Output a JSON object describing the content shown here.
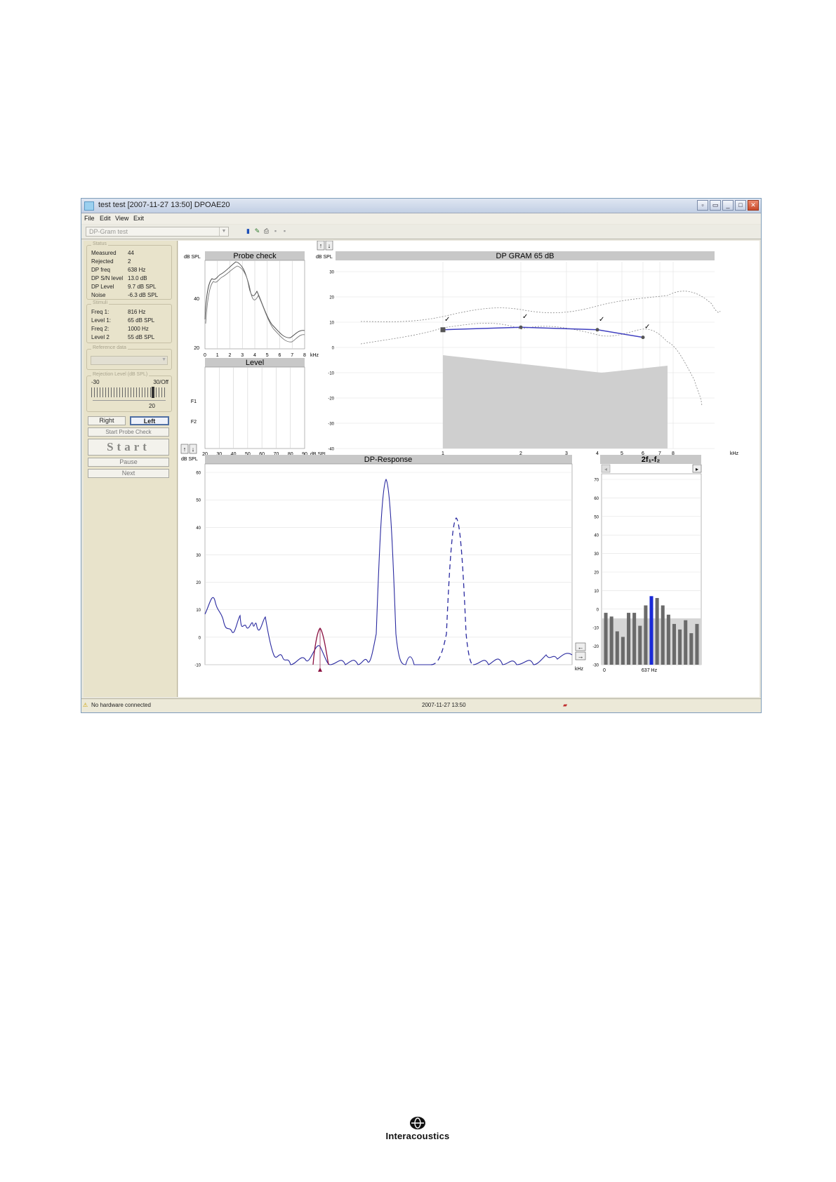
{
  "window": {
    "title": "test test [2007-11-27 13:50] DPOAE20",
    "buttons": [
      "minimize-to-tray",
      "restore-small",
      "minimize",
      "maximize",
      "close"
    ]
  },
  "menu": [
    "File",
    "Edit",
    "View",
    "Exit"
  ],
  "toolbar": {
    "protocol": "DP-Gram test"
  },
  "left_panel": {
    "status_title": "Status",
    "status": [
      {
        "label": "Measured",
        "value": "44"
      },
      {
        "label": "Rejected",
        "value": "2"
      },
      {
        "label": "DP freq",
        "value": "638 Hz"
      },
      {
        "label": "DP S/N level",
        "value": "13.0 dB"
      },
      {
        "label": "DP Level",
        "value": "9.7 dB SPL"
      },
      {
        "label": "Noise",
        "value": "-6.3 dB SPL"
      }
    ],
    "stimuli_title": "Stimuli",
    "stimuli": [
      {
        "label": "Freq 1:",
        "value": "816 Hz"
      },
      {
        "label": "Level 1:",
        "value": "65 dB SPL"
      },
      {
        "label": "Freq 2:",
        "value": "1000 Hz"
      },
      {
        "label": "Level 2",
        "value": "55 dB SPL"
      }
    ],
    "reference_title": "Reference data",
    "reject_title": "Rejection Level (dB SPL)",
    "reject_min": "-30",
    "reject_max": "30/Off",
    "reject_value": "20",
    "buttons": {
      "right": "Right",
      "left": "Left",
      "probe_check": "Start Probe Check",
      "start": "Start",
      "pause": "Pause",
      "next": "Next"
    }
  },
  "charts": {
    "probe_check": {
      "title": "Probe check",
      "ylabel": "dB SPL",
      "xunit": "kHz",
      "yticks": [
        "40",
        "20"
      ],
      "xticks": [
        "0",
        "1",
        "2",
        "3",
        "4",
        "5",
        "6",
        "7",
        "8"
      ]
    },
    "level": {
      "title": "Level",
      "ytick_labels": [
        "F1",
        "F2"
      ],
      "xticks": [
        "20",
        "30",
        "40",
        "50",
        "60",
        "70",
        "80",
        "90"
      ],
      "xunit": "dB SPL"
    },
    "dp_gram": {
      "title": "DP GRAM 65 dB",
      "ylabel": "dB SPL",
      "xunit": "kHz",
      "yticks": [
        "30",
        "20",
        "10",
        "0",
        "-10",
        "-20",
        "-30",
        "-40"
      ],
      "xticks": [
        "1",
        "2",
        "3",
        "4",
        "5",
        "6",
        "7",
        "8"
      ]
    },
    "dp_response": {
      "title": "DP-Response",
      "ylabel": "dB SPL",
      "xunit": "kHz",
      "yticks": [
        "60",
        "50",
        "40",
        "30",
        "20",
        "10",
        "0",
        "-10"
      ]
    },
    "two_f1_f2": {
      "title": "2f₁-f₂",
      "yticks": [
        "70",
        "60",
        "50",
        "40",
        "30",
        "20",
        "10",
        "0",
        "-10",
        "-20",
        "-30"
      ],
      "x_left": "0",
      "x_center": "637 Hz"
    }
  },
  "chart_data": [
    {
      "type": "line",
      "title": "DP GRAM 65 dB",
      "xlabel": "kHz",
      "ylabel": "dB SPL",
      "ylim": [
        -40,
        30
      ],
      "series": [
        {
          "x": [
            1,
            2,
            4,
            6
          ],
          "values": [
            7,
            8,
            7,
            4
          ]
        }
      ]
    },
    {
      "type": "bar",
      "title": "2f₁-f₂",
      "x_label": "637 Hz",
      "ylim": [
        -30,
        70
      ],
      "values": [
        -2,
        -4,
        -12,
        -15,
        -2,
        -2,
        -9,
        2,
        7,
        6,
        2,
        -3,
        -8,
        -11,
        -6,
        -13,
        -8
      ]
    }
  ],
  "status": {
    "message": "No hardware connected",
    "timestamp": "2007-11-27 13:50"
  },
  "logo": {
    "name": "Interacoustics"
  }
}
